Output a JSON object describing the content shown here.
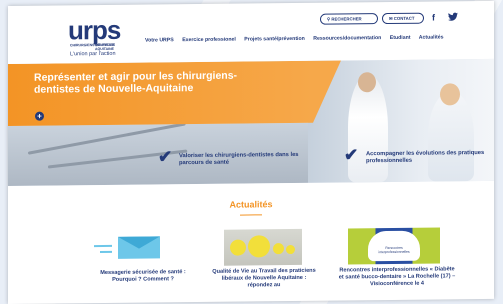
{
  "header": {
    "logo_word": "urps",
    "logo_sub_left": "CHIRURGIENS DENTISTES",
    "logo_sub_right": "NOUVELLE AQUITAINE",
    "logo_tagline": "L'union par l'action",
    "search_label": "RECHERCHER",
    "contact_label": "CONTACT",
    "social": {
      "facebook": "f",
      "twitter": "🐦"
    },
    "nav": [
      "Votre URPS",
      "Exercice professionel",
      "Projets santé/prévention",
      "Ressources/documentation",
      "Etudiant",
      "Actualités"
    ]
  },
  "hero": {
    "title": "Représenter et agir pour les chirurgiens-dentistes de Nouvelle-Aquitaine",
    "more_label": "+",
    "cards": [
      {
        "text": "Valoriser les chirurgiens-dentistes dans les parcours de santé"
      },
      {
        "text": "Accompagner les évolutions des pratiques professionnelles"
      }
    ]
  },
  "news": {
    "title": "Actualités",
    "items": [
      {
        "caption": "Messagerie sécurisée de santé : Pourquoi ? Comment ?"
      },
      {
        "caption": "Qualité de Vie au Travail des praticiens libéraux de Nouvelle Aquitaine : répondez au"
      },
      {
        "caption": "Rencontres interprofessionnelles « Diabète et santé bucco-dentaire » La Rochelle (17) – Visioconférence le 4",
        "thumb_text": "Rencontres interprofessionnelles"
      }
    ]
  },
  "colors": {
    "brand": "#243a79",
    "accent": "#f39425"
  }
}
